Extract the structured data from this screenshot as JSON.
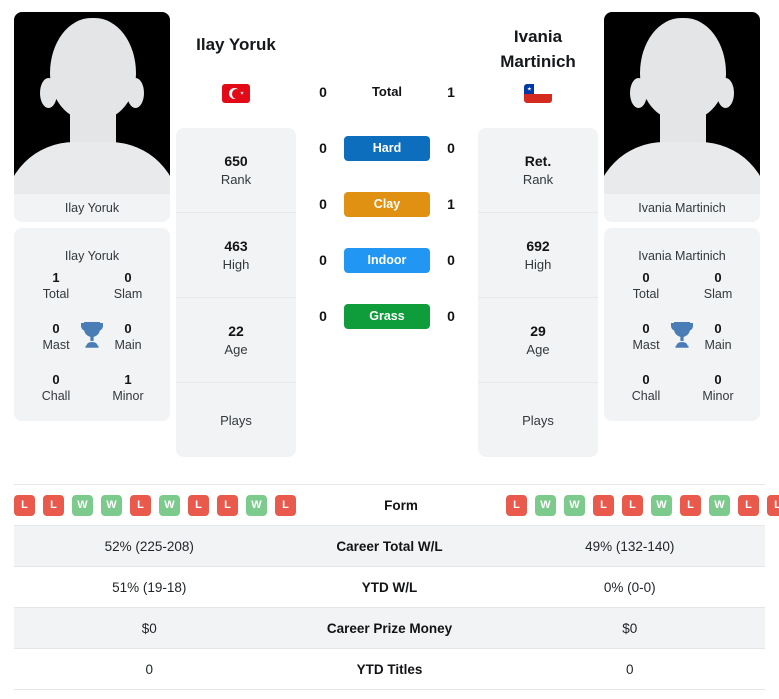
{
  "players": {
    "left": {
      "name": "Ilay Yoruk",
      "photo_caption": "Ilay Yoruk",
      "flag": "turkey-flag",
      "rank": "650",
      "rank_label": "Rank",
      "high": "463",
      "high_label": "High",
      "age": "22",
      "age_label": "Age",
      "plays": "",
      "plays_label": "Plays",
      "titles_header": "Ilay Yoruk",
      "titles": [
        {
          "value": "1",
          "label": "Total"
        },
        {
          "value": "0",
          "label": "Slam"
        },
        {
          "value": "0",
          "label": "Mast"
        },
        {
          "value": "0",
          "label": "Main"
        },
        {
          "value": "0",
          "label": "Chall"
        },
        {
          "value": "1",
          "label": "Minor"
        }
      ]
    },
    "right": {
      "name": "Ivania Martinich",
      "photo_caption": "Ivania Martinich",
      "flag": "chile-flag",
      "rank": "Ret.",
      "rank_label": "Rank",
      "high": "692",
      "high_label": "High",
      "age": "29",
      "age_label": "Age",
      "plays": "",
      "plays_label": "Plays",
      "titles_header": "Ivania Martinich",
      "titles": [
        {
          "value": "0",
          "label": "Total"
        },
        {
          "value": "0",
          "label": "Slam"
        },
        {
          "value": "0",
          "label": "Mast"
        },
        {
          "value": "0",
          "label": "Main"
        },
        {
          "value": "0",
          "label": "Chall"
        },
        {
          "value": "0",
          "label": "Minor"
        }
      ]
    }
  },
  "h2h": {
    "rows": [
      {
        "label": "Total",
        "left": "0",
        "right": "1",
        "style": "plain",
        "color": ""
      },
      {
        "label": "Hard",
        "left": "0",
        "right": "0",
        "style": "pill",
        "color": "#0d6ebd"
      },
      {
        "label": "Clay",
        "left": "0",
        "right": "1",
        "style": "pill",
        "color": "#e09112"
      },
      {
        "label": "Indoor",
        "left": "0",
        "right": "0",
        "style": "pill",
        "color": "#2196f3"
      },
      {
        "label": "Grass",
        "left": "0",
        "right": "0",
        "style": "pill",
        "color": "#0f9d3c"
      }
    ]
  },
  "comparison": {
    "form_label": "Form",
    "form_left": [
      "L",
      "L",
      "W",
      "W",
      "L",
      "W",
      "L",
      "L",
      "W",
      "L"
    ],
    "form_right": [
      "L",
      "W",
      "W",
      "L",
      "L",
      "W",
      "L",
      "W",
      "L",
      "L"
    ],
    "rows": [
      {
        "label": "Career Total W/L",
        "left": "52% (225-208)",
        "right": "49% (132-140)"
      },
      {
        "label": "YTD W/L",
        "left": "51% (19-18)",
        "right": "0% (0-0)"
      },
      {
        "label": "Career Prize Money",
        "left": "$0",
        "right": "$0"
      },
      {
        "label": "YTD Titles",
        "left": "0",
        "right": "0"
      }
    ]
  },
  "colors": {
    "win": "#7ccb8c",
    "loss": "#e9594c",
    "trophy": "#4a7cb5",
    "card_bg": "#f1f3f4"
  }
}
